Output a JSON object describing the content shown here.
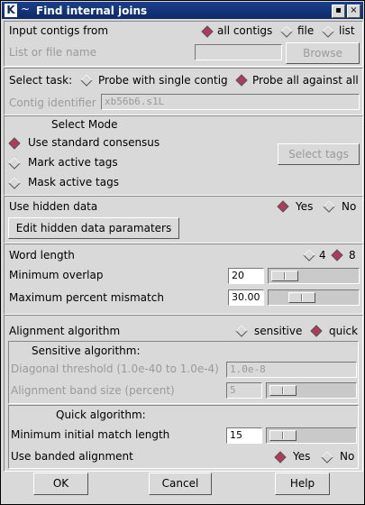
{
  "window": {
    "title": "Find internal joins",
    "logo": "K",
    "menu_glyph": "~",
    "min_label": "▪",
    "close_label": "×"
  },
  "input": {
    "label": "Input contigs from",
    "options": [
      "all contigs",
      "file",
      "list"
    ],
    "selected": "all contigs",
    "list_label": "List or file name",
    "list_value": "",
    "browse": "Browse"
  },
  "task": {
    "label": "Select task:",
    "options": [
      "Probe with single contig",
      "Probe all against all"
    ],
    "selected": "Probe all against all",
    "contig_label": "Contig identifier",
    "contig_value": "xb56b6.s1L"
  },
  "mode": {
    "title": "Select Mode",
    "options": [
      "Use standard consensus",
      "Mark active tags",
      "Mask active tags"
    ],
    "selected": "Use standard consensus",
    "select_tags": "Select tags"
  },
  "hidden": {
    "label": "Use hidden data",
    "options": [
      "Yes",
      "No"
    ],
    "selected": "Yes",
    "edit_button": "Edit hidden data paramaters"
  },
  "word": {
    "label": "Word length",
    "options": [
      "4",
      "8"
    ],
    "selected": "8",
    "min_overlap_label": "Minimum overlap",
    "min_overlap_value": "20",
    "max_mismatch_label": "Maximum percent mismatch",
    "max_mismatch_value": "30.00"
  },
  "align": {
    "label": "Alignment algorithm",
    "options": [
      "sensitive",
      "quick"
    ],
    "selected": "quick",
    "sensitive": {
      "title": "Sensitive algorithm:",
      "diag_label": "Diagonal threshold (1.0e-40 to 1.0e-4)",
      "diag_value": "1.0e-8",
      "band_label": "Alignment band size (percent)",
      "band_value": "5"
    },
    "quick": {
      "title": "Quick algorithm:",
      "min_match_label": "Minimum initial match length",
      "min_match_value": "15",
      "banded_label": "Use banded alignment",
      "options": [
        "Yes",
        "No"
      ],
      "selected": "Yes"
    }
  },
  "footer": {
    "ok": "OK",
    "cancel": "Cancel",
    "help": "Help"
  },
  "colors": {
    "radio_selected": "#b03a5a",
    "titlebar": "#0e2a66"
  }
}
